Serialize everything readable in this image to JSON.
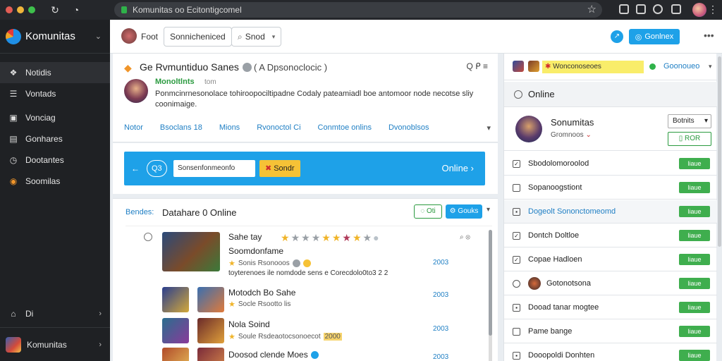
{
  "browser": {
    "url": "Komunitas oo Ecitontigcomel"
  },
  "sidebar": {
    "brand": "Komunitas",
    "items": [
      {
        "label": "Notidis",
        "icon": "paw-icon"
      },
      {
        "label": "Vontads",
        "icon": "list-icon"
      },
      {
        "label": "Vonciag",
        "icon": "image-icon"
      },
      {
        "label": "Gonhares",
        "icon": "grid-icon"
      },
      {
        "label": "Dootantes",
        "icon": "clock-icon"
      },
      {
        "label": "Soomilas",
        "icon": "logo-icon"
      }
    ],
    "bottom_item": "Di",
    "footer_label": "Komunitas"
  },
  "topbar": {
    "user_label": "Foot",
    "button1": "Sonnicheniced",
    "button2": "Snod",
    "primary": "Gonlnex"
  },
  "header": {
    "title": "Ge Rvmuntiduo Sanes",
    "subtitle": "( A Dpsonoclocic )",
    "actions": "Q ᑭ ≡",
    "author_name": "Monoltlnts",
    "author_meta": "tom",
    "description": "Ponmcinrnesonolace tohiroopociltipadne Codaly pateamiadl boe antomoor node necotse sliy coonimaige.",
    "tabs": [
      "Notor",
      "Bsoclans 18",
      "Mions",
      "Rvonoctol Ci",
      "Conmtoe onlins",
      "Dvonoblsos"
    ]
  },
  "banner": {
    "pill": "Q3",
    "field": "Sonsenfonmeonfo",
    "button": "Sondr",
    "online": "Online"
  },
  "list": {
    "left_label": "Bendes:",
    "title": "Datahare 0 Online",
    "btn1": "Oti",
    "btn2": "Gouks",
    "rows": [
      {
        "title": "Sahe tay",
        "subtitle": "Soomdonfame",
        "meta": "Sonis  Rsonooos",
        "num": "2003",
        "line": "toyterenoes  ile nomdode sens e Corecdolo0to3 2 2"
      },
      {
        "title": "Motodch Bo Sahe",
        "meta": "Socle  Rsootto lis",
        "num": "2003"
      },
      {
        "title": "Nola Soind",
        "meta": "Soule  Rsdeaotocsonoecot",
        "highlight": "2000",
        "num": "2003"
      },
      {
        "title": "Doosod clende Moes",
        "num": "2003"
      }
    ]
  },
  "right": {
    "yellow_label": "Wonconoseoes",
    "online_label": "Goonoueo",
    "section": "Online",
    "profile_name": "Sonumitas",
    "profile_sub": "Gromnoos",
    "select": "Botnits",
    "outline_btn": "ROR",
    "btn_label": "liaue",
    "rows": [
      {
        "label": "Sbodolomoroolod",
        "check": "✓"
      },
      {
        "label": "Sopanoogstiont",
        "check": ""
      },
      {
        "label": "Dogeolt Sononctomeomd",
        "check": "▪",
        "blue": true
      },
      {
        "label": "Dontch Doltloe",
        "check": "✓"
      },
      {
        "label": "Copae Hadloen",
        "check": "✓"
      },
      {
        "label": "Gotonotsona",
        "avatar": true
      },
      {
        "label": "Dooad tanar mogtee",
        "check": "▪"
      },
      {
        "label": "Pame bange",
        "check": ""
      },
      {
        "label": "Dooopoldi Donhten",
        "check": "▪"
      }
    ]
  },
  "colors": {
    "accent": "#1ea1e8",
    "success": "#3fae4e",
    "sidebar": "#1f2124",
    "highlight": "#f9ed6a"
  }
}
